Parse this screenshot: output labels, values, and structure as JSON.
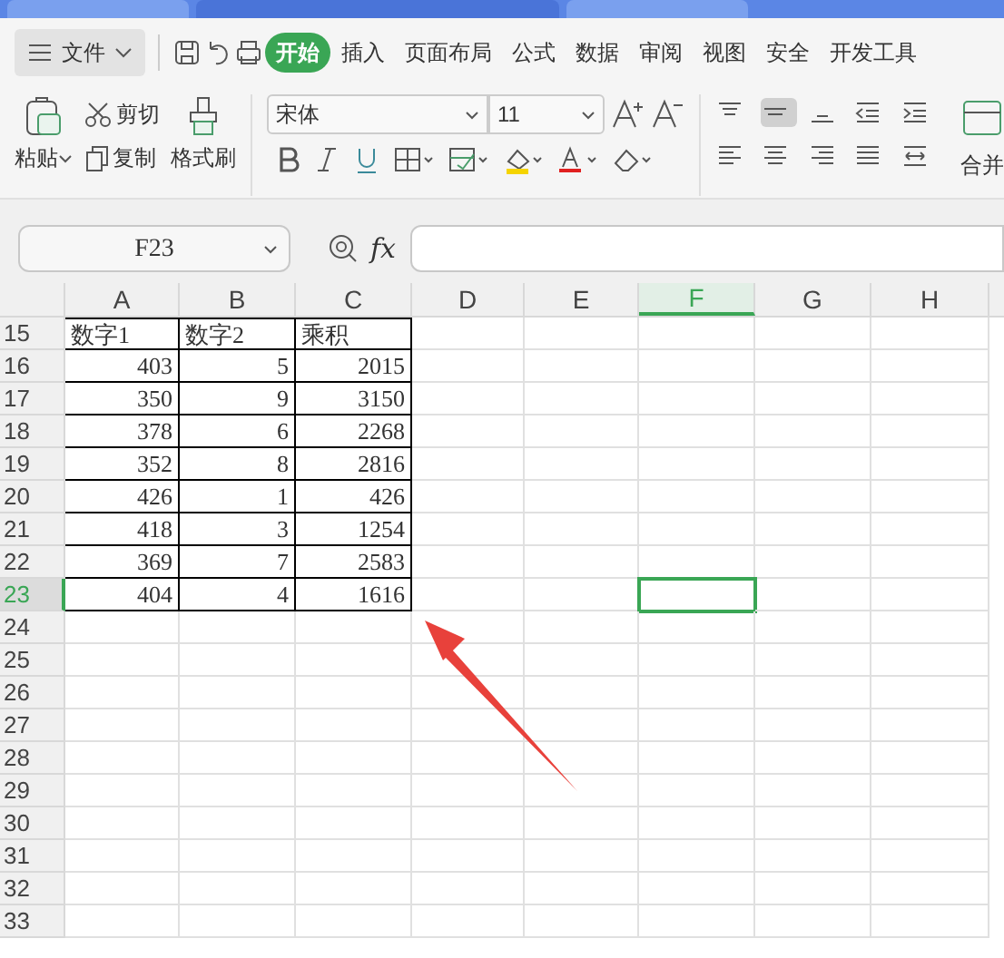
{
  "title_tabs": [
    {
      "selected": false
    },
    {
      "selected": true
    },
    {
      "selected": false
    }
  ],
  "menu": {
    "file": "文件",
    "tabs": [
      {
        "label": "开始",
        "selected": true
      },
      {
        "label": "插入",
        "selected": false
      },
      {
        "label": "页面布局",
        "selected": false
      },
      {
        "label": "公式",
        "selected": false
      },
      {
        "label": "数据",
        "selected": false
      },
      {
        "label": "审阅",
        "selected": false
      },
      {
        "label": "视图",
        "selected": false
      },
      {
        "label": "安全",
        "selected": false
      },
      {
        "label": "开发工具",
        "selected": false
      }
    ]
  },
  "ribbon": {
    "paste": "粘贴",
    "cut": "剪切",
    "copy": "复制",
    "format_painter": "格式刷",
    "font": "宋体",
    "font_size": "11",
    "merge": "合并"
  },
  "formula_bar": {
    "name_box": "F23",
    "fx": "fx"
  },
  "columns": [
    {
      "label": "A",
      "selected": false
    },
    {
      "label": "B",
      "selected": false
    },
    {
      "label": "C",
      "selected": false
    },
    {
      "label": "D",
      "selected": false
    },
    {
      "label": "E",
      "selected": false
    },
    {
      "label": "F",
      "selected": true
    },
    {
      "label": "G",
      "selected": false
    },
    {
      "label": "H",
      "selected": false
    }
  ],
  "rows": [
    {
      "number": "15",
      "selected": false,
      "kind": "header",
      "cells": [
        "数字1",
        "数字2",
        "乘积"
      ]
    },
    {
      "number": "16",
      "selected": false,
      "kind": "data",
      "cells": [
        "403",
        "5",
        "2015"
      ]
    },
    {
      "number": "17",
      "selected": false,
      "kind": "data",
      "cells": [
        "350",
        "9",
        "3150"
      ]
    },
    {
      "number": "18",
      "selected": false,
      "kind": "data",
      "cells": [
        "378",
        "6",
        "2268"
      ]
    },
    {
      "number": "19",
      "selected": false,
      "kind": "data",
      "cells": [
        "352",
        "8",
        "2816"
      ]
    },
    {
      "number": "20",
      "selected": false,
      "kind": "data",
      "cells": [
        "426",
        "1",
        "426"
      ]
    },
    {
      "number": "21",
      "selected": false,
      "kind": "data",
      "cells": [
        "418",
        "3",
        "1254"
      ]
    },
    {
      "number": "22",
      "selected": false,
      "kind": "data",
      "cells": [
        "369",
        "7",
        "2583"
      ]
    },
    {
      "number": "23",
      "selected": true,
      "kind": "data",
      "cells": [
        "404",
        "4",
        "1616"
      ]
    },
    {
      "number": "24",
      "selected": false,
      "kind": "empty",
      "cells": []
    },
    {
      "number": "25",
      "selected": false,
      "kind": "empty",
      "cells": []
    },
    {
      "number": "26",
      "selected": false,
      "kind": "empty",
      "cells": []
    },
    {
      "number": "27",
      "selected": false,
      "kind": "empty",
      "cells": []
    },
    {
      "number": "28",
      "selected": false,
      "kind": "empty",
      "cells": []
    },
    {
      "number": "29",
      "selected": false,
      "kind": "empty",
      "cells": []
    },
    {
      "number": "30",
      "selected": false,
      "kind": "empty",
      "cells": []
    },
    {
      "number": "31",
      "selected": false,
      "kind": "empty",
      "cells": []
    },
    {
      "number": "32",
      "selected": false,
      "kind": "empty",
      "cells": []
    },
    {
      "number": "33",
      "selected": false,
      "kind": "empty",
      "cells": []
    }
  ],
  "annotations": [
    {
      "kind": "arrow"
    }
  ]
}
